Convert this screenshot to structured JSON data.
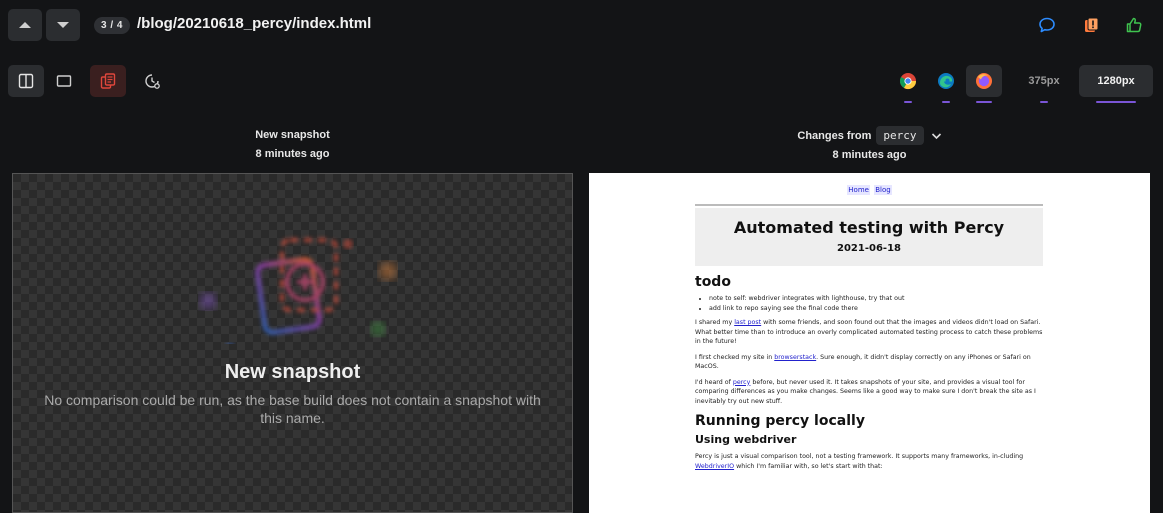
{
  "header": {
    "counter": "3 / 4",
    "path": "/blog/20210618_percy/index.html"
  },
  "icons": {
    "prev": "chevron-up-icon",
    "next": "chevron-down-icon",
    "comment": "comment-icon",
    "request_changes": "request-changes-icon",
    "approve": "thumbs-up-icon",
    "split_view": "split-view-icon",
    "single_view": "single-view-icon",
    "diff_toggle": "diff-toggle-icon",
    "history": "history-icon",
    "chrome": "chrome-icon",
    "edge": "edge-icon",
    "firefox": "firefox-icon"
  },
  "colors": {
    "comment": "#2d8cff",
    "request_changes": "#ff7a3c",
    "approve": "#3fc34f",
    "diff_toggle": "#e0473c",
    "browser_underline": "#7a55d6"
  },
  "widths": [
    "375px",
    "1280px"
  ],
  "columns": {
    "left": {
      "title": "New snapshot",
      "time": "8 minutes ago"
    },
    "right": {
      "prefix": "Changes from",
      "base": "percy",
      "time": "8 minutes ago"
    }
  },
  "new_snapshot": {
    "title": "New snapshot",
    "description": "No comparison could be run, as the base build does not contain a snapshot with this name."
  },
  "snapshot_page": {
    "nav": [
      "Home",
      "Blog"
    ],
    "title": "Automated testing with Percy",
    "date": "2021-06-18",
    "todo_heading": "todo",
    "todo_items": [
      "note to self: webdriver integrates with lighthouse, try that out",
      "add link to repo saying see the final code there"
    ],
    "p1_before": "I shared my ",
    "p1_link": "last post",
    "p1_after": " with some friends, and soon found out that the images and videos didn't load on Safari. What better time than to introduce an overly complicated automated testing process to catch these problems in the future!",
    "p2_before": "I first checked my site in ",
    "p2_link": "browserstack",
    "p2_after": ". Sure enough, it didn't display correctly on any iPhones or Safari on MacOS.",
    "p3_before": "I'd heard of ",
    "p3_link": "percy",
    "p3_after": " before, but never used it. It takes snapshots of your site, and provides a visual tool for comparing differences as you make changes. Seems like a good way to make sure I don't break the site as I inevitably try out new stuff.",
    "h2": "Running percy locally",
    "h3": "Using webdriver",
    "p4_before": "Percy is just a visual comparison tool, not a testing framework. It supports many frameworks, in-cluding ",
    "p4_link": "WebdriverIO",
    "p4_after": " which I'm familiar with, so let's start with that:"
  }
}
